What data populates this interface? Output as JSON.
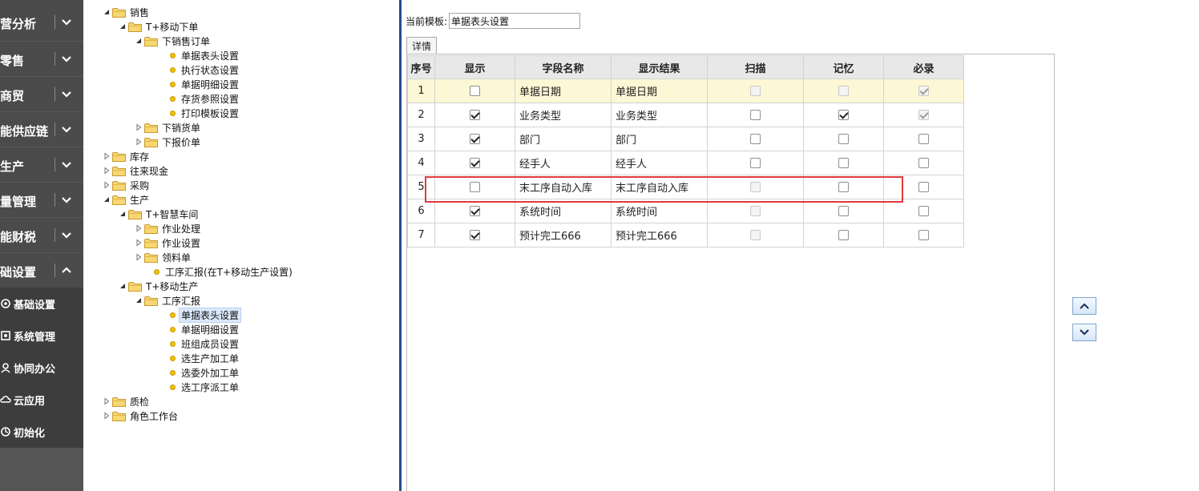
{
  "nav": {
    "items": [
      {
        "label": "营分析",
        "expanded": false
      },
      {
        "label": "零售",
        "expanded": false
      },
      {
        "label": "商贸",
        "expanded": false
      },
      {
        "label": "能供应链",
        "expanded": false
      },
      {
        "label": "生产",
        "expanded": false
      },
      {
        "label": "量管理",
        "expanded": false
      },
      {
        "label": "能财税",
        "expanded": false
      },
      {
        "label": "础设置",
        "expanded": true
      }
    ],
    "sub_items": [
      {
        "label": "基础设置",
        "icon": "settings-icon"
      },
      {
        "label": "系统管理",
        "icon": "system-icon"
      },
      {
        "label": "协同办公",
        "icon": "collab-icon"
      },
      {
        "label": "云应用",
        "icon": "cloud-icon"
      },
      {
        "label": "初始化",
        "icon": "init-icon"
      }
    ]
  },
  "tree": {
    "nodes": [
      {
        "label": "销售",
        "type": "folder",
        "expanded": true
      },
      {
        "label": "T+移动下单",
        "type": "folder",
        "expanded": true
      },
      {
        "label": "下销售订单",
        "type": "folder",
        "expanded": true
      },
      {
        "label": "单据表头设置",
        "type": "leaf"
      },
      {
        "label": "执行状态设置",
        "type": "leaf"
      },
      {
        "label": "单据明细设置",
        "type": "leaf"
      },
      {
        "label": "存货参照设置",
        "type": "leaf"
      },
      {
        "label": "打印模板设置",
        "type": "leaf"
      },
      {
        "label": "下销货单",
        "type": "folder",
        "expanded": false
      },
      {
        "label": "下报价单",
        "type": "folder",
        "expanded": false
      },
      {
        "label": "库存",
        "type": "folder",
        "expanded": false
      },
      {
        "label": "往来现金",
        "type": "folder",
        "expanded": false
      },
      {
        "label": "采购",
        "type": "folder",
        "expanded": false
      },
      {
        "label": "生产",
        "type": "folder",
        "expanded": true
      },
      {
        "label": "T+智慧车间",
        "type": "folder",
        "expanded": true
      },
      {
        "label": "作业处理",
        "type": "folder",
        "expanded": false
      },
      {
        "label": "作业设置",
        "type": "folder",
        "expanded": false
      },
      {
        "label": "领料单",
        "type": "folder",
        "expanded": false
      },
      {
        "label": "工序汇报(在T+移动生产设置)",
        "type": "leaf"
      },
      {
        "label": "T+移动生产",
        "type": "folder",
        "expanded": true
      },
      {
        "label": "工序汇报",
        "type": "folder",
        "expanded": true
      },
      {
        "label": "单据表头设置",
        "type": "leaf",
        "selected": true
      },
      {
        "label": "单据明细设置",
        "type": "leaf"
      },
      {
        "label": "班组成员设置",
        "type": "leaf"
      },
      {
        "label": "选生产加工单",
        "type": "leaf"
      },
      {
        "label": "选委外加工单",
        "type": "leaf"
      },
      {
        "label": "选工序派工单",
        "type": "leaf"
      },
      {
        "label": "质检",
        "type": "folder",
        "expanded": false
      },
      {
        "label": "角色工作台",
        "type": "folder",
        "expanded": false
      }
    ]
  },
  "template": {
    "label": "当前模板:",
    "value": "单据表头设置"
  },
  "tab": {
    "label": "详情"
  },
  "grid": {
    "columns": [
      "序号",
      "显示",
      "字段名称",
      "显示结果",
      "扫描",
      "记忆",
      "必录"
    ],
    "rows": [
      {
        "no": "1",
        "show": false,
        "field": "单据日期",
        "result": "单据日期",
        "scan": false,
        "scan_disabled": true,
        "memo": false,
        "memo_disabled": true,
        "req": true,
        "req_disabled": true
      },
      {
        "no": "2",
        "show": true,
        "field": "业务类型",
        "result": "业务类型",
        "scan": false,
        "scan_disabled": false,
        "memo": true,
        "memo_disabled": false,
        "req": true,
        "req_disabled": true
      },
      {
        "no": "3",
        "show": true,
        "field": "部门",
        "result": "部门",
        "scan": false,
        "scan_disabled": false,
        "memo": false,
        "memo_disabled": false,
        "req": false,
        "req_disabled": false
      },
      {
        "no": "4",
        "show": true,
        "field": "经手人",
        "result": "经手人",
        "scan": false,
        "scan_disabled": false,
        "memo": false,
        "memo_disabled": false,
        "req": false,
        "req_disabled": false
      },
      {
        "no": "5",
        "show": false,
        "field": "末工序自动入库",
        "result": "末工序自动入库",
        "scan": false,
        "scan_disabled": true,
        "memo": false,
        "memo_disabled": false,
        "req": false,
        "req_disabled": false
      },
      {
        "no": "6",
        "show": true,
        "field": "系统时间",
        "result": "系统时间",
        "scan": false,
        "scan_disabled": true,
        "memo": false,
        "memo_disabled": false,
        "req": false,
        "req_disabled": false
      },
      {
        "no": "7",
        "show": true,
        "field": "预计完工666",
        "result": "预计完工666",
        "scan": false,
        "scan_disabled": true,
        "memo": false,
        "memo_disabled": false,
        "req": false,
        "req_disabled": false
      }
    ]
  },
  "buttons": {
    "move_up": "chevron-up-icon",
    "move_down": "chevron-down-icon"
  },
  "colors": {
    "nav_bg": "#4b4b4b",
    "subnav_bg": "#3d3d3d",
    "highlight_row": "#fcf7d4",
    "annotation_box": "#e03a3a"
  }
}
